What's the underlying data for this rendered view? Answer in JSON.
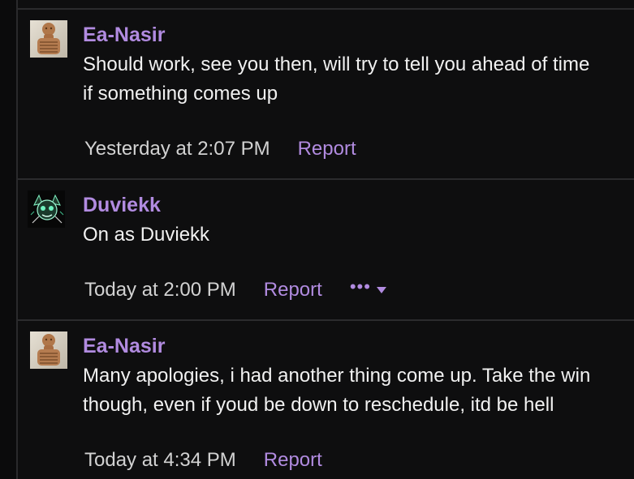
{
  "posts": [
    {
      "author": "Ea-Nasir",
      "avatar_icon": "clay-statue-avatar-icon",
      "body_lines": [
        "Should work, see you then, will try to tell you ahead of time",
        "if something comes up"
      ],
      "timestamp": "Yesterday at 2:07 PM",
      "report_label": "Report"
    },
    {
      "author": "Duviekk",
      "avatar_icon": "green-creature-avatar-icon",
      "body_lines": [
        "On as Duviekk"
      ],
      "timestamp": "Today at 2:00 PM",
      "report_label": "Report",
      "more_menu": {
        "dots": "•••",
        "icon": "chevron-down-icon"
      }
    },
    {
      "author": "Ea-Nasir",
      "avatar_icon": "clay-statue-avatar-icon",
      "body_lines": [
        "Many apologies, i had another thing come up. Take the win",
        "though, even if youd be down to reschedule, itd be hell"
      ],
      "timestamp": "Today at 4:34 PM",
      "report_label": "Report"
    }
  ],
  "colors": {
    "background": "#0e0e0f",
    "author": "#b18be0",
    "link": "#b18be0",
    "body_text": "#f1f1f1",
    "timestamp": "#d2d2d2",
    "divider": "#2b2b2d"
  }
}
